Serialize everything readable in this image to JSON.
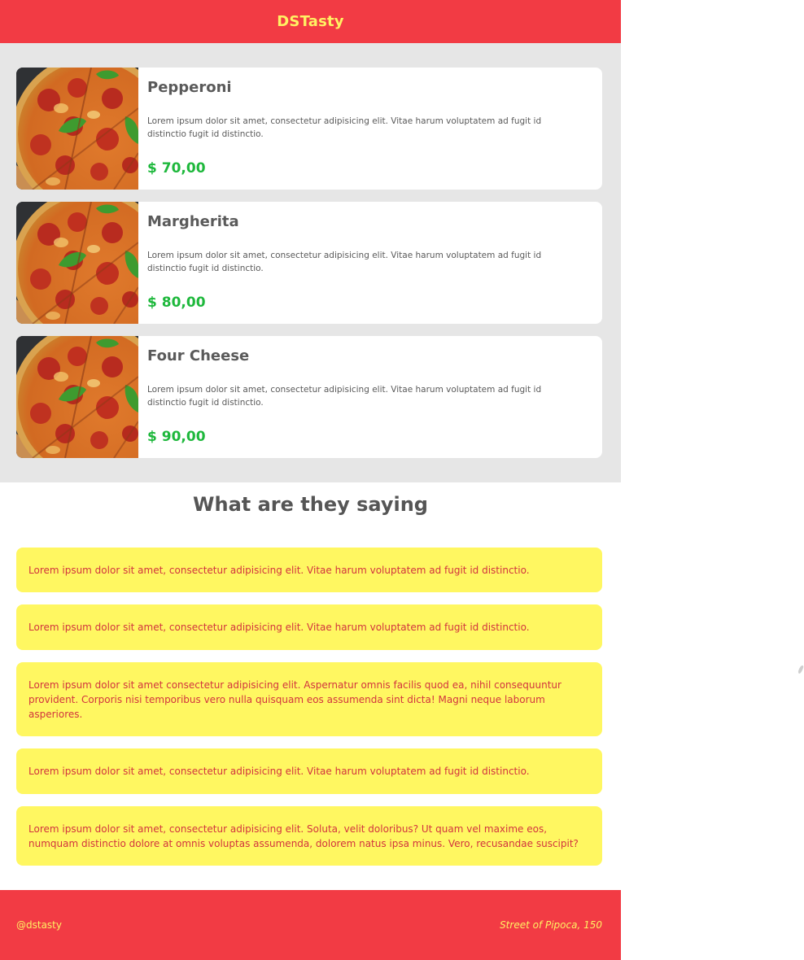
{
  "header": {
    "brand": "DSTasty"
  },
  "menu": {
    "items": [
      {
        "name": "Pepperoni",
        "description": "Lorem ipsum dolor sit amet, consectetur adipisicing elit. Vitae harum voluptatem ad fugit id distinctio fugit id distinctio.",
        "price": "$ 70,00",
        "image_icon": "pizza-image"
      },
      {
        "name": "Margherita",
        "description": "Lorem ipsum dolor sit amet, consectetur adipisicing elit. Vitae harum voluptatem ad fugit id distinctio fugit id distinctio.",
        "price": "$ 80,00",
        "image_icon": "pizza-image"
      },
      {
        "name": "Four Cheese",
        "description": "Lorem ipsum dolor sit amet, consectetur adipisicing elit. Vitae harum voluptatem ad fugit id distinctio fugit id distinctio.",
        "price": "$ 90,00",
        "image_icon": "pizza-image"
      }
    ]
  },
  "testimonials": {
    "title": "What are they saying",
    "items": [
      "Lorem ipsum dolor sit amet, consectetur adipisicing elit. Vitae harum voluptatem ad fugit id distinctio.",
      "Lorem ipsum dolor sit amet, consectetur adipisicing elit. Vitae harum voluptatem ad fugit id distinctio.",
      "Lorem ipsum dolor sit amet consectetur adipisicing elit. Aspernatur omnis facilis quod ea, nihil consequuntur provident. Corporis nisi temporibus vero nulla quisquam eos assumenda sint dicta! Magni neque laborum asperiores.",
      "Lorem ipsum dolor sit amet, consectetur adipisicing elit. Vitae harum voluptatem ad fugit id distinctio.",
      "Lorem ipsum dolor sit amet, consectetur adipisicing elit. Soluta, velit doloribus? Ut quam vel maxime eos, numquam distinctio dolore at omnis voluptas assumenda, dolorem natus ipsa minus. Vero, recusandae suscipit?"
    ]
  },
  "footer": {
    "handle": "@dstasty",
    "address": "Street of Pipoca, 150"
  },
  "colors": {
    "brand_red": "#f23b44",
    "brand_yellow": "#fff163",
    "price_green": "#1eb83c",
    "review_bg": "#fff761",
    "review_text": "#d2343e"
  }
}
